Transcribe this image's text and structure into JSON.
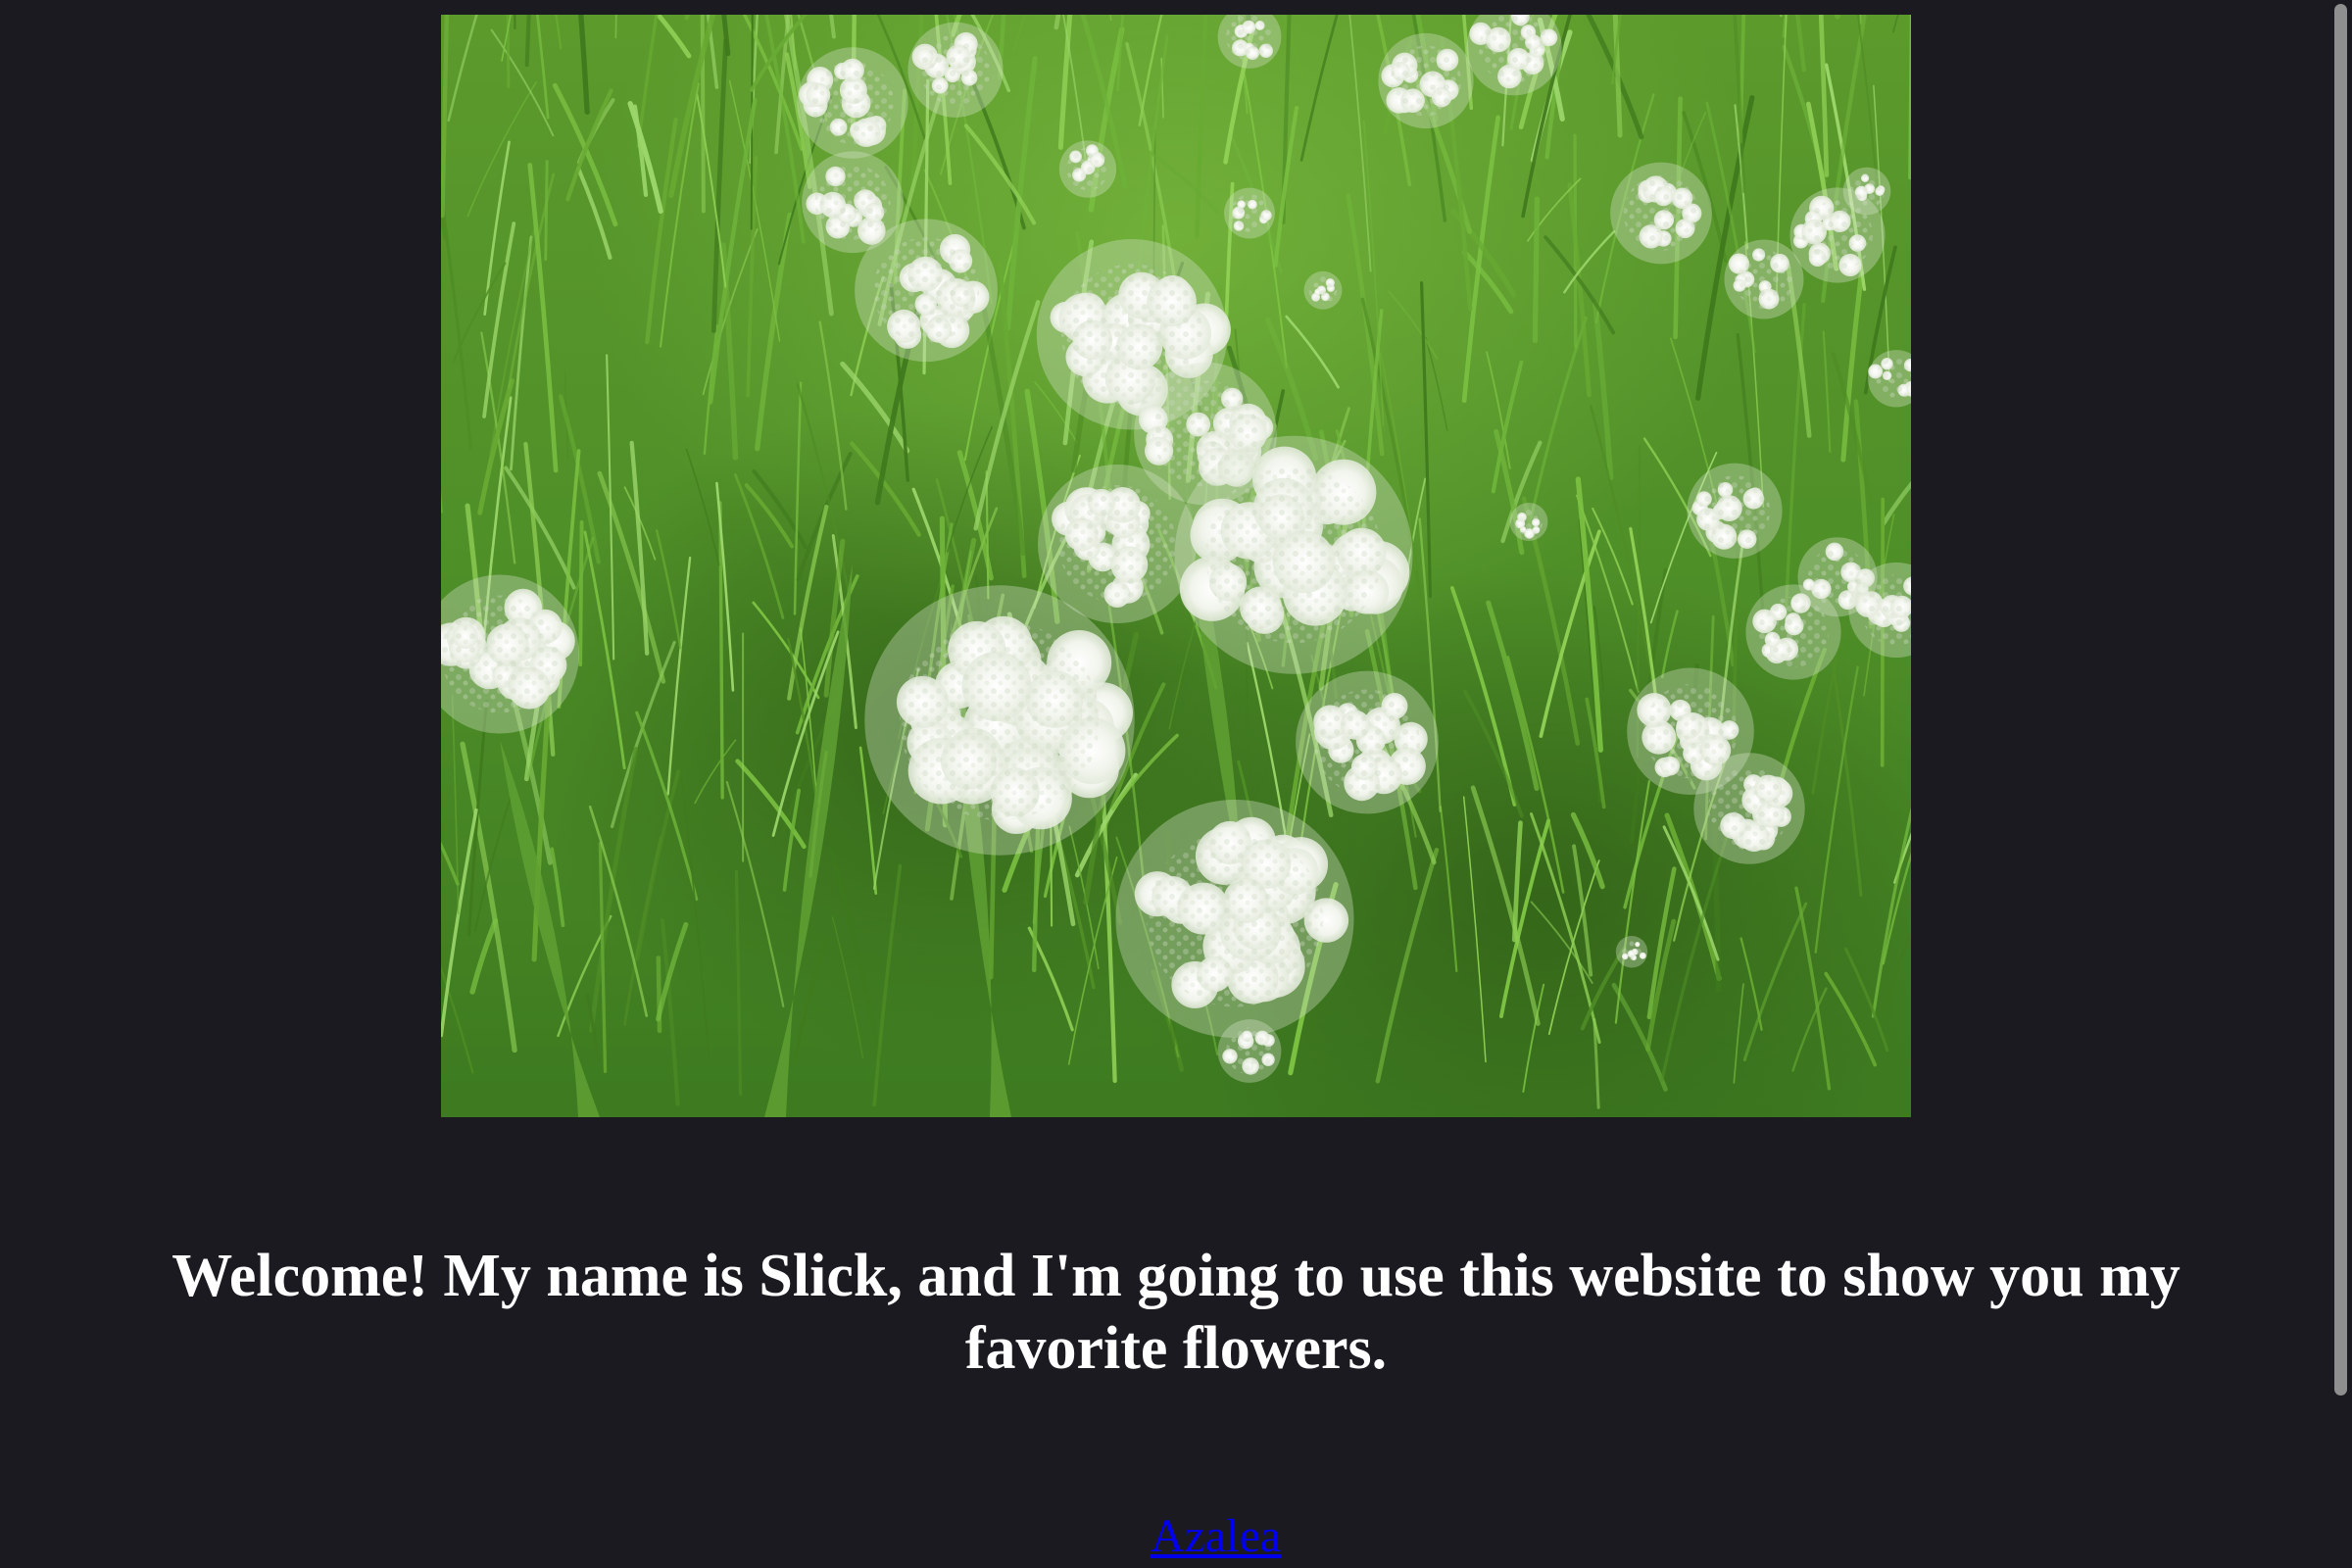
{
  "colors": {
    "background": "#1c1a21",
    "heading": "#ffffff",
    "link": "#0000ee",
    "scrollbar_thumb": "#8f8f8f"
  },
  "hero_image": {
    "subject": "white Queen Anne's lace flowers in green grass"
  },
  "welcome": {
    "line1": "Welcome! My name is Slick, and I'm going to use this website to show you my",
    "line2": "favorite flowers."
  },
  "links": [
    {
      "label": "Azalea"
    }
  ]
}
